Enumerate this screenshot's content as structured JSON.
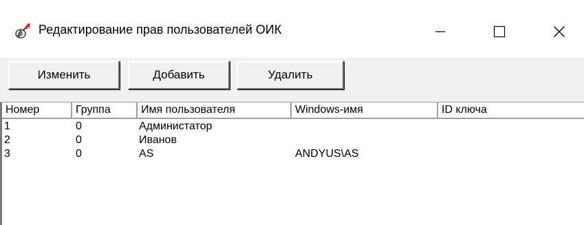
{
  "window": {
    "title": "Редактирование прав пользователей ОИК",
    "icon": "key-user-icon",
    "controls": {
      "minimize": "—",
      "maximize": "☐",
      "close": "✕"
    }
  },
  "toolbar": {
    "edit_label": "Изменить",
    "add_label": "Добавить",
    "delete_label": "Удалить"
  },
  "table": {
    "columns": [
      "Номер",
      "Группа",
      "Имя пользователя",
      "Windows-имя",
      "ID ключа"
    ],
    "rows": [
      {
        "num": "1",
        "group": "0",
        "name": "Администатор",
        "winname": "",
        "keyid": ""
      },
      {
        "num": "2",
        "group": "0",
        "name": "Иванов",
        "winname": "",
        "keyid": ""
      },
      {
        "num": "3",
        "group": "0",
        "name": "AS",
        "winname": "ANDYUS\\AS",
        "keyid": ""
      }
    ]
  }
}
